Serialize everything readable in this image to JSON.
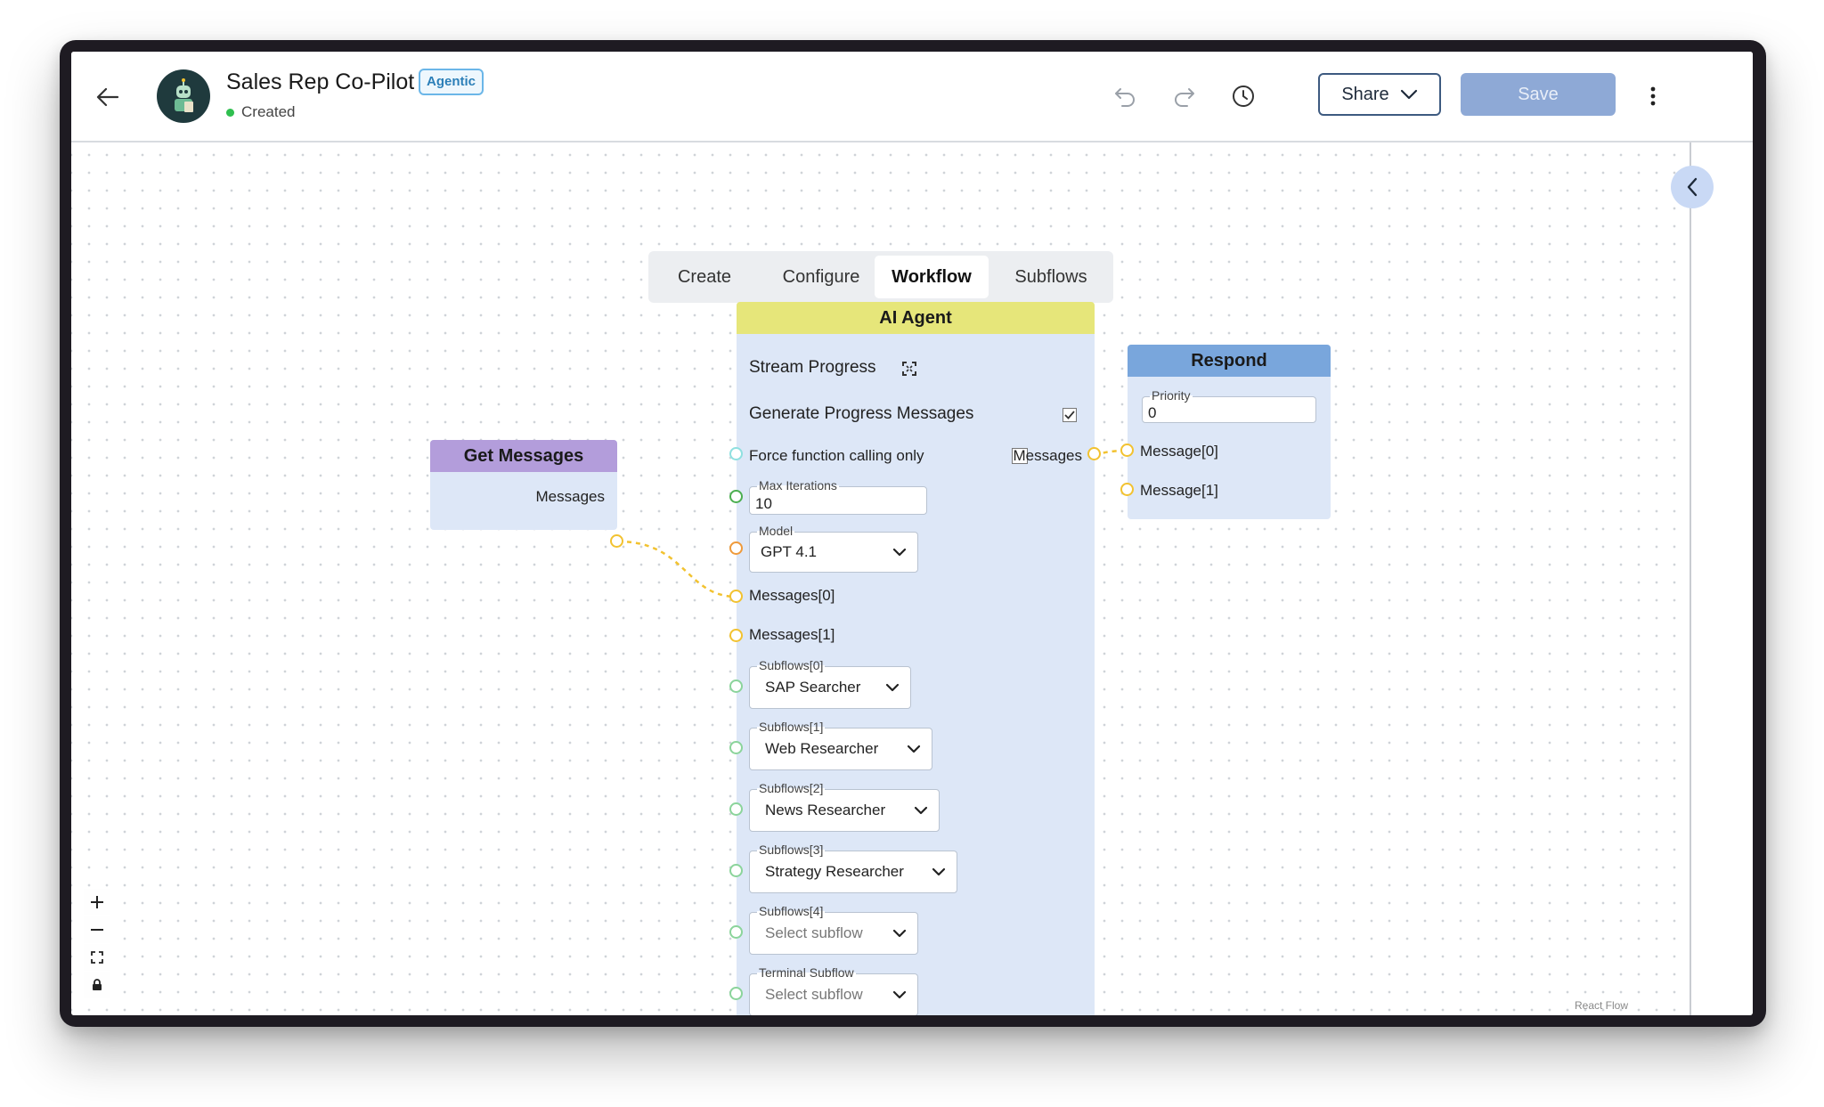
{
  "header": {
    "title": "Sales Rep Co-Pilot",
    "badge": "Agentic",
    "status": "Created",
    "share_label": "Share",
    "save_label": "Save"
  },
  "tabs": [
    {
      "label": "Create",
      "active": false
    },
    {
      "label": "Configure",
      "active": false
    },
    {
      "label": "Workflow",
      "active": true
    },
    {
      "label": "Subflows",
      "active": false
    }
  ],
  "nodes": {
    "get_messages": {
      "title": "Get Messages",
      "output_label": "Messages"
    },
    "ai_agent": {
      "title": "AI Agent",
      "stream_progress_label": "Stream Progress",
      "generate_progress_label": "Generate Progress Messages",
      "generate_progress_checked": true,
      "force_function_label": "Force function calling only",
      "force_function_checked": false,
      "output_label": "Messages",
      "max_iterations": {
        "label": "Max Iterations",
        "value": "10"
      },
      "model": {
        "label": "Model",
        "value": "GPT 4.1"
      },
      "messages_inputs": [
        "Messages[0]",
        "Messages[1]"
      ],
      "subflows": [
        {
          "label": "Subflows[0]",
          "value": "SAP Searcher",
          "placeholder": false
        },
        {
          "label": "Subflows[1]",
          "value": "Web Researcher",
          "placeholder": false
        },
        {
          "label": "Subflows[2]",
          "value": "News Researcher",
          "placeholder": false
        },
        {
          "label": "Subflows[3]",
          "value": "Strategy Researcher",
          "placeholder": false
        },
        {
          "label": "Subflows[4]",
          "value": "Select subflow",
          "placeholder": true
        }
      ],
      "terminal_subflow": {
        "label": "Terminal Subflow",
        "value": "Select subflow",
        "placeholder": true
      }
    },
    "respond": {
      "title": "Respond",
      "priority": {
        "label": "Priority",
        "value": "0"
      },
      "inputs": [
        "Message[0]",
        "Message[1]"
      ]
    }
  },
  "attribution": "React Flow",
  "colors": {
    "ai_agent_header": "#e6e67a",
    "get_messages_header": "#b39ddb",
    "respond_header": "#79a6dc",
    "node_body": "#dde7f7",
    "edge": "#f2c230",
    "save_button": "#8ea9d6"
  },
  "icons": [
    "back-arrow-icon",
    "agent-avatar-icon",
    "undo-icon",
    "redo-icon",
    "history-clock-icon",
    "chevron-down-icon",
    "more-vertical-icon",
    "chevron-left-icon",
    "expand-icon",
    "zoom-in-icon",
    "zoom-out-icon",
    "fit-view-icon",
    "lock-icon"
  ]
}
